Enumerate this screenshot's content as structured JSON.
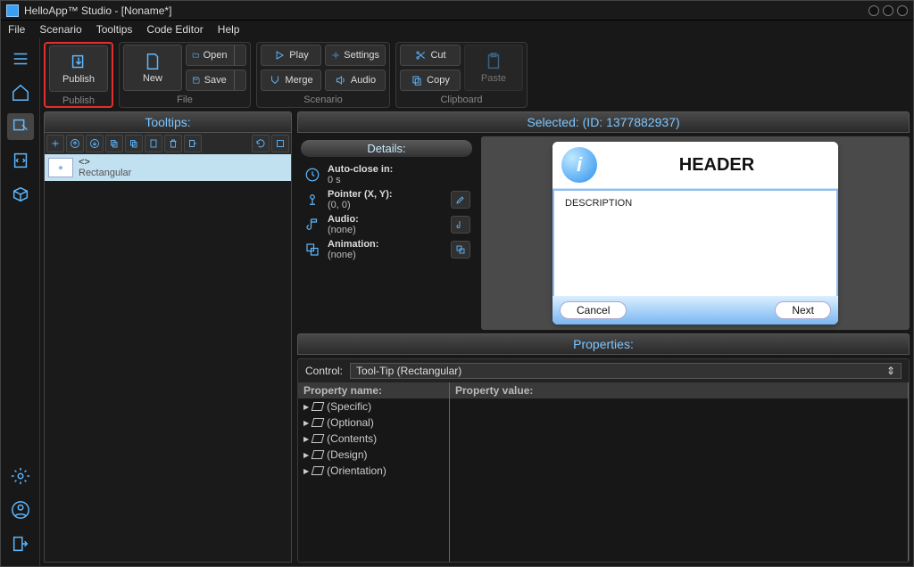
{
  "title": "HelloApp™ Studio - [Noname*]",
  "menu": [
    "File",
    "Scenario",
    "Tooltips",
    "Code Editor",
    "Help"
  ],
  "ribbon": {
    "publish": {
      "label": "Publish",
      "group": "Publish"
    },
    "file": {
      "new": "New",
      "open": "Open",
      "save": "Save",
      "group": "File"
    },
    "scenario": {
      "play": "Play",
      "merge": "Merge",
      "settings": "Settings",
      "audio": "Audio",
      "group": "Scenario"
    },
    "clipboard": {
      "cut": "Cut",
      "copy": "Copy",
      "paste": "Paste",
      "group": "Clipboard"
    }
  },
  "tooltips_panel": {
    "title": "Tooltips:",
    "item": {
      "title": "<>",
      "subtitle": "Rectangular"
    }
  },
  "selected": {
    "title": "Selected:  (ID: 1377882937)"
  },
  "details": {
    "title": "Details:",
    "auto_close_label": "Auto-close in:",
    "auto_close_val": "0 s",
    "pointer_label": "Pointer (X, Y):",
    "pointer_val": "(0, 0)",
    "audio_label": "Audio:",
    "audio_val": "(none)",
    "anim_label": "Animation:",
    "anim_val": "(none)"
  },
  "preview": {
    "header": "HEADER",
    "description": "DESCRIPTION",
    "cancel": "Cancel",
    "next": "Next"
  },
  "properties": {
    "title": "Properties:",
    "control_label": "Control:",
    "control_value": "Tool-Tip (Rectangular)",
    "col1": "Property name:",
    "col2": "Property value:",
    "nodes": [
      "(Specific)",
      "(Optional)",
      "(Contents)",
      "(Design)",
      "(Orientation)"
    ]
  }
}
